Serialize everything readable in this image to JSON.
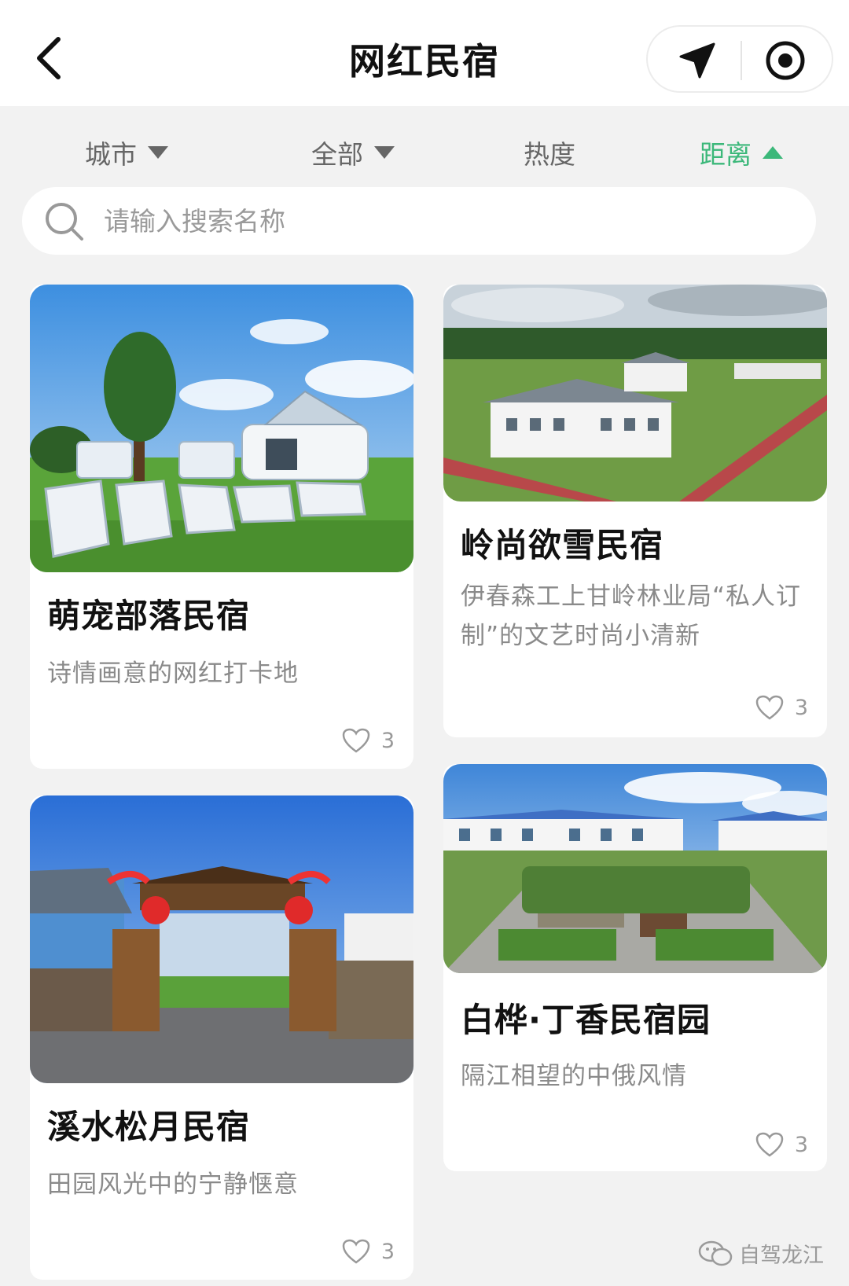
{
  "header": {
    "title": "网红民宿",
    "back_icon": "chevron-left-icon",
    "location_icon": "navigation-arrow-icon",
    "record_icon": "target-circle-icon"
  },
  "filters": [
    {
      "label": "城市",
      "indicator": "caret-down",
      "active": false
    },
    {
      "label": "全部",
      "indicator": "caret-down",
      "active": false
    },
    {
      "label": "热度",
      "indicator": "",
      "active": false
    },
    {
      "label": "距离",
      "indicator": "caret-up",
      "active": true
    }
  ],
  "colors": {
    "accent": "#3cb87a",
    "background": "#f2f2f2",
    "card": "#ffffff"
  },
  "search": {
    "placeholder": "请输入搜索名称",
    "value": ""
  },
  "cards": [
    {
      "name": "萌宠部落民宿",
      "desc": "诗情画意的网红打卡地",
      "likes": "3"
    },
    {
      "name": "岭尚欲雪民宿",
      "desc": "伊春森工上甘岭林业局“私人订制”的文艺时尚小清新",
      "likes": "3"
    },
    {
      "name": "溪水松月民宿",
      "desc": "田园风光中的宁静惬意",
      "likes": "3"
    },
    {
      "name": "白桦·丁香民宿园",
      "desc": "隔江相望的中俄风情",
      "likes": "3"
    }
  ],
  "watermark": {
    "text": "自驾龙江"
  }
}
